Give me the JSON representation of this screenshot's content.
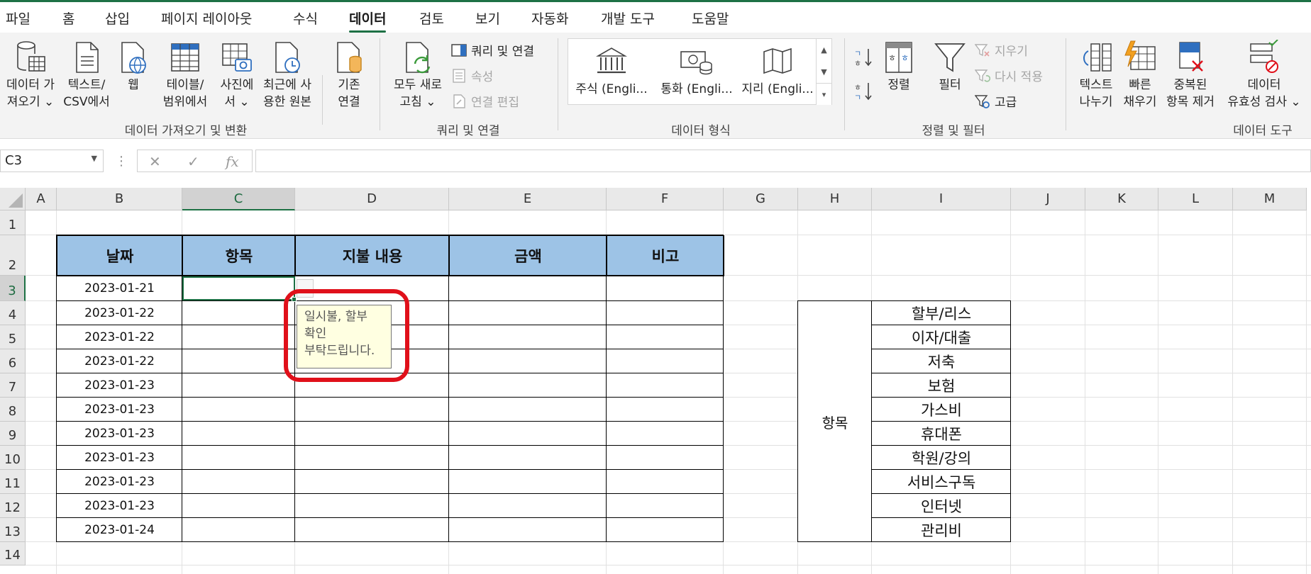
{
  "ribbon_tabs": [
    {
      "label": "파일"
    },
    {
      "label": "홈"
    },
    {
      "label": "삽입"
    },
    {
      "label": "페이지 레이아웃"
    },
    {
      "label": "수식"
    },
    {
      "label": "데이터"
    },
    {
      "label": "검토"
    },
    {
      "label": "보기"
    },
    {
      "label": "자동화"
    },
    {
      "label": "개발 도구"
    },
    {
      "label": "도움말"
    }
  ],
  "active_tab": "데이터",
  "ribbon": {
    "get_data": "데이터 가\n져오기 ⌄",
    "text_csv": "텍스트/\nCSV에서",
    "web": "웹",
    "table_range": "테이블/\n범위에서",
    "from_picture": "사진에\n서 ⌄",
    "recent_sources": "최근에 사\n용한 원본",
    "existing_conn": "기존\n연결",
    "group_get_transform": "데이터 가져오기 및 변환",
    "refresh_all": "모두 새로\n고침 ⌄",
    "queries_connections": "쿼리 및 연결",
    "properties": "속성",
    "edit_links": "연결 편집",
    "group_queries": "쿼리 및 연결",
    "stocks": "주식 (Engli...",
    "currencies": "통화 (Engli...",
    "geography": "지리 (Engli...",
    "group_data_types": "데이터 형식",
    "sort": "정렬",
    "filter": "필터",
    "clear": "지우기",
    "reapply": "다시 적용",
    "advanced": "고급",
    "group_sort_filter": "정렬 및 필터",
    "text_to_columns": "텍스트\n나누기",
    "flash_fill": "빠른\n채우기",
    "remove_duplicates": "중복된\n항목 제거",
    "data_validation": "데이터\n유효성 검사 ⌄",
    "group_data_tools": "데이터 도구"
  },
  "formula_bar": {
    "name_box": "C3",
    "fx": "fx",
    "cancel": "✕",
    "enter": "✓",
    "value": ""
  },
  "columns": [
    "A",
    "B",
    "C",
    "D",
    "E",
    "F",
    "G",
    "H",
    "I",
    "J",
    "K",
    "L",
    "M"
  ],
  "rows": [
    "1",
    "2",
    "3",
    "4",
    "5",
    "6",
    "7",
    "8",
    "9",
    "10",
    "11",
    "12",
    "13",
    "14"
  ],
  "selected_cell": "C3",
  "table": {
    "headers": [
      "날짜",
      "항목",
      "지불 내용",
      "금액",
      "비고"
    ],
    "dates": [
      "2023-01-21",
      "2023-01-22",
      "2023-01-22",
      "2023-01-22",
      "2023-01-23",
      "2023-01-23",
      "2023-01-23",
      "2023-01-23",
      "2023-01-23",
      "2023-01-23",
      "2023-01-24"
    ]
  },
  "category_list": {
    "label": "항목",
    "items": [
      "할부/리스",
      "이자/대출",
      "저축",
      "보험",
      "가스비",
      "휴대폰",
      "학원/강의",
      "서비스구독",
      "인터넷",
      "관리비"
    ]
  },
  "tooltip": {
    "lines": [
      "일시불, 할부",
      "확인",
      "부탁드립니다."
    ]
  },
  "colors": {
    "accent": "#1e7145",
    "header_fill": "#9dc3e6",
    "highlight": "#e0101a",
    "tooltip_bg": "#ffffe1"
  }
}
